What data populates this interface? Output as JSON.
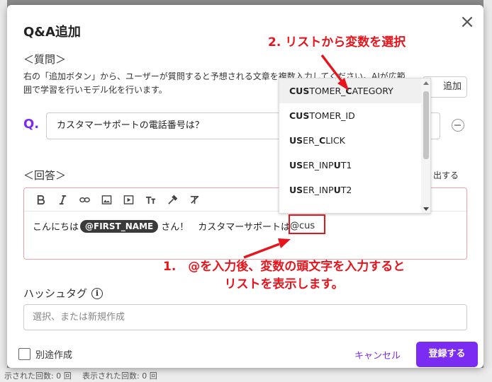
{
  "dialog": {
    "title": "Q&A追加",
    "close_symbol": "×"
  },
  "question": {
    "heading": "＜質問＞",
    "description": "右の「追加ボタン」から、ユーザーが質問すると予想される文章を複数入力してください。AIが広範囲で学習を行いモデル化を行います。",
    "add_button_label": "追加",
    "label": "Q.",
    "input_value": "カスタマーサポートの電話番号は？"
  },
  "answer": {
    "heading": "＜回答＞",
    "background_suffix": "出する",
    "editor": {
      "toolbar_icons": [
        "bold-icon",
        "italic-icon",
        "link-icon",
        "image-icon",
        "video-icon",
        "text-size-icon",
        "color-picker-icon",
        "clear-format-icon"
      ],
      "text_before": "こんにちは",
      "variable_chip": "@FIRST_NAME",
      "text_after": "さん！　カスタマーサポートは",
      "typed_text": "@cus"
    }
  },
  "variable_dropdown": {
    "items": [
      {
        "bold": "CUS",
        "rest_a": "TOMER_",
        "bold2": "C",
        "rest_b": "ATEGORY",
        "selected": true
      },
      {
        "bold": "CUS",
        "rest_a": "TOMER_ID",
        "bold2": "",
        "rest_b": "",
        "selected": false
      },
      {
        "bold": "US",
        "rest_a": "ER_",
        "bold2": "C",
        "rest_b": "LICK",
        "selected": false
      },
      {
        "bold": "US",
        "rest_a": "ER_INP",
        "bold2": "U",
        "rest_b": "T1",
        "selected": false
      },
      {
        "bold": "US",
        "rest_a": "ER_INP",
        "bold2": "U",
        "rest_b": "T2",
        "selected": false
      }
    ]
  },
  "annotations": {
    "step2": "2. リストから変数を選択",
    "step1_line1": "1.　@を入力後、変数の頭文字を入力すると",
    "step1_line2": "リストを表示します。",
    "color": "#e8141c"
  },
  "hashtag": {
    "label": "ハッシュタグ",
    "info_symbol": "i",
    "placeholder": "選択、または新規作成"
  },
  "footer": {
    "checkbox_label": "別途作成",
    "cancel_label": "キャンセル",
    "register_label": "登録する"
  },
  "background": {
    "footer_text_1": "示された回数: 0 回",
    "footer_text_2": "表示された回数: 0 回"
  },
  "colors": {
    "accent": "#7b2cf2",
    "error_border": "#f1a0a8"
  }
}
